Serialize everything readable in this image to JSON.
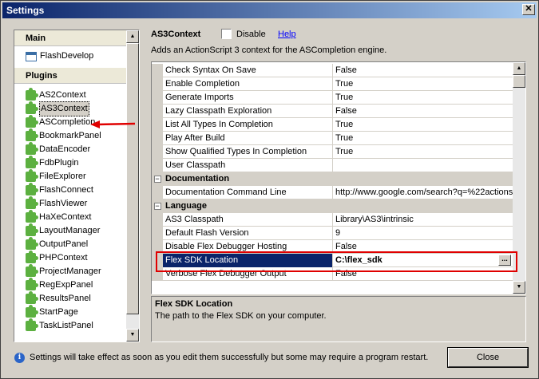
{
  "window": {
    "title": "Settings"
  },
  "sidebar": {
    "main_header": "Main",
    "main_items": [
      {
        "label": "FlashDevelop",
        "icon": "window-icon"
      }
    ],
    "plugins_header": "Plugins",
    "plugins": [
      "AS2Context",
      "AS3Context",
      "ASCompletion",
      "BookmarkPanel",
      "DataEncoder",
      "FdbPlugin",
      "FileExplorer",
      "FlashConnect",
      "FlashViewer",
      "HaXeContext",
      "LayoutManager",
      "OutputPanel",
      "PHPContext",
      "ProjectManager",
      "RegExpPanel",
      "ResultsPanel",
      "StartPage",
      "TaskListPanel"
    ],
    "selected": "AS3Context"
  },
  "plugin_header": {
    "title": "AS3Context",
    "disable_label": "Disable",
    "help_label": "Help",
    "description": "Adds an ActionScript 3 context for the ASCompletion engine."
  },
  "grid": {
    "rows": [
      {
        "type": "prop",
        "name": "Check Syntax On Save",
        "value": "False"
      },
      {
        "type": "prop",
        "name": "Enable Completion",
        "value": "True"
      },
      {
        "type": "prop",
        "name": "Generate Imports",
        "value": "True"
      },
      {
        "type": "prop",
        "name": "Lazy Classpath Exploration",
        "value": "False"
      },
      {
        "type": "prop",
        "name": "List All Types In Completion",
        "value": "True"
      },
      {
        "type": "prop",
        "name": "Play After Build",
        "value": "True"
      },
      {
        "type": "prop",
        "name": "Show Qualified Types In Completion",
        "value": "True"
      },
      {
        "type": "prop",
        "name": "User Classpath",
        "value": ""
      },
      {
        "type": "cat",
        "name": "Documentation"
      },
      {
        "type": "prop",
        "name": "Documentation Command Line",
        "value": "http://www.google.com/search?q=%22actions"
      },
      {
        "type": "cat",
        "name": "Language"
      },
      {
        "type": "prop",
        "name": "AS3 Classpath",
        "value": "Library\\AS3\\intrinsic"
      },
      {
        "type": "prop",
        "name": "Default Flash Version",
        "value": "9"
      },
      {
        "type": "prop",
        "name": "Disable Flex Debugger Hosting",
        "value": "False"
      },
      {
        "type": "selected",
        "name": "Flex SDK Location",
        "value": "C:\\flex_sdk",
        "button": "..."
      },
      {
        "type": "prop",
        "name": "Verbose Flex Debugger Output",
        "value": "False"
      }
    ]
  },
  "description_panel": {
    "title": "Flex SDK Location",
    "text": "The path to the Flex SDK on your computer."
  },
  "footer": {
    "message": "Settings will take effect as soon as you edit them successfully but some may require a program restart.",
    "close_label": "Close"
  },
  "colors": {
    "selection": "#0a246a",
    "highlight_box": "#e00000",
    "arrow": "#e00000",
    "plugin_icon": "#5cb040"
  }
}
